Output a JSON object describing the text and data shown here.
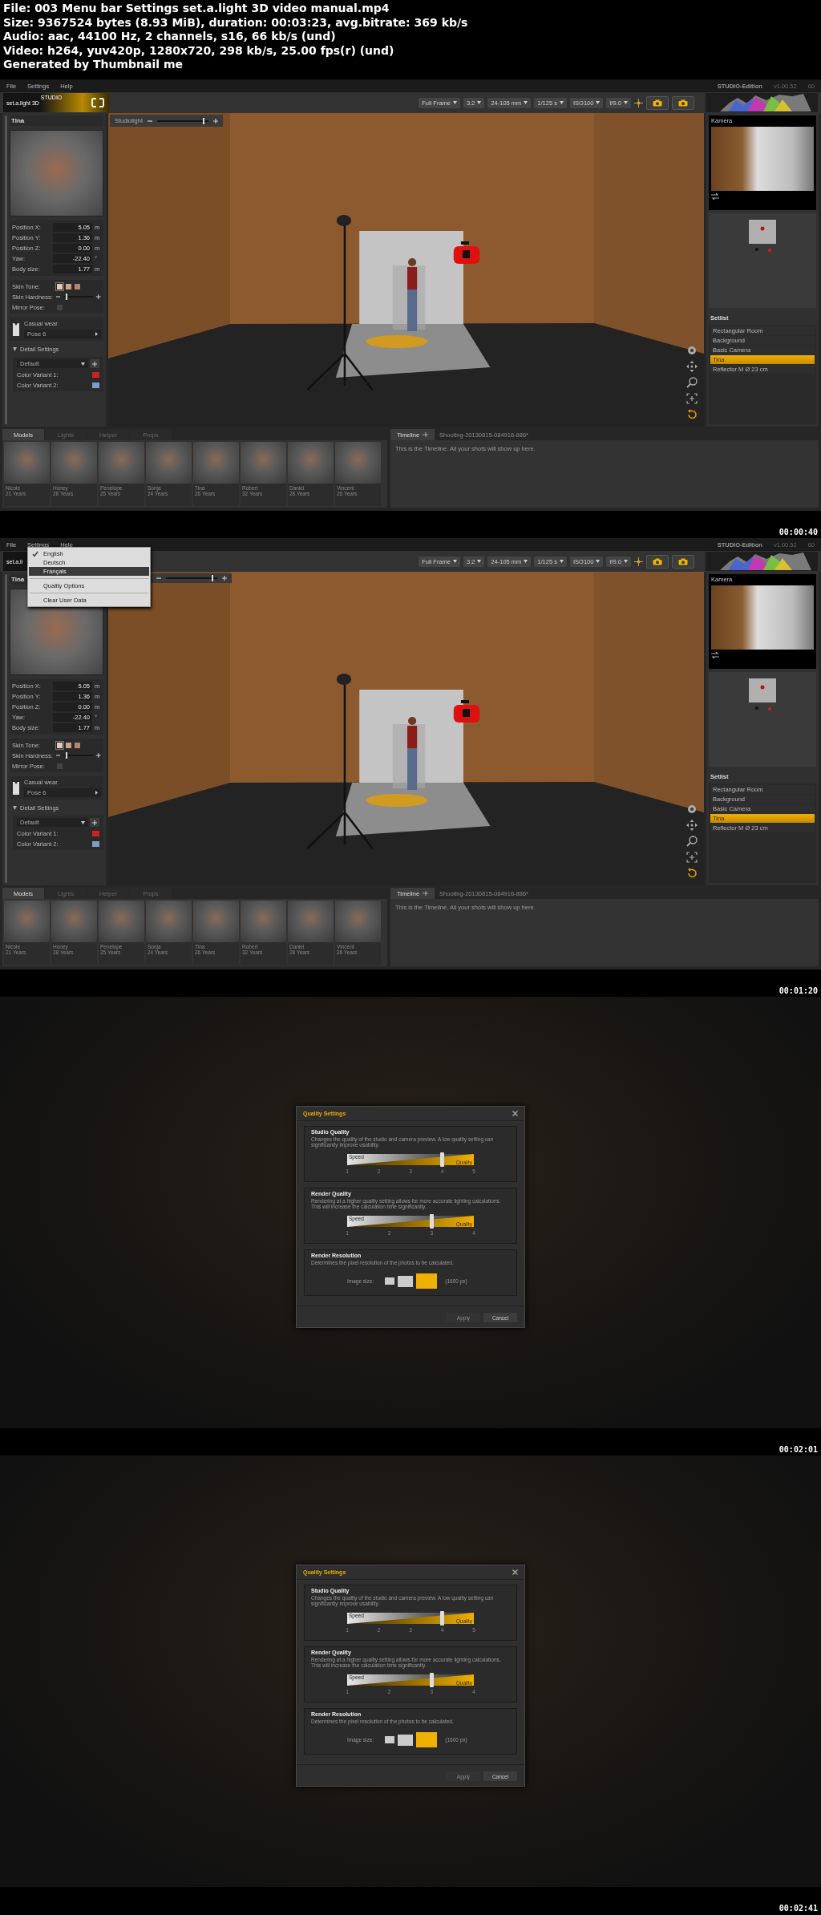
{
  "header": {
    "lines": [
      "File: 003 Menu bar  Settings   set.a.light 3D video manual.mp4",
      "Size: 9367524 bytes (8.93 MiB), duration: 00:03:23, avg.bitrate: 369 kb/s",
      "Audio: aac, 44100 Hz, 2 channels, s16, 66 kb/s (und)",
      "Video: h264, yuv420p, 1280x720, 298 kb/s, 25.00 fps(r) (und)",
      "Generated by Thumbnail me"
    ]
  },
  "frames": [
    {
      "timestamp": "00:00:40",
      "app": {
        "menubar": [
          "File",
          "Settings",
          "Help"
        ],
        "edition": "STUDIO-Edition",
        "version": "v1.00.52",
        "build": "60",
        "logo": "set.a.light 3D",
        "logo_edition": "STUDIO",
        "camera_settings": [
          "Full Frame",
          "3:2",
          "24-105 mm",
          "1/125 s",
          "ISO100",
          "f/9.0"
        ],
        "model_panel": {
          "title": "Tina",
          "fields": [
            {
              "label": "Position X:",
              "value": "5.05",
              "unit": "m"
            },
            {
              "label": "Position Y:",
              "value": "1.36",
              "unit": "m"
            },
            {
              "label": "Position Z:",
              "value": "0.00",
              "unit": "m"
            },
            {
              "label": "Yaw:",
              "value": "-22.40",
              "unit": "°"
            },
            {
              "label": "Body size:",
              "value": "1.77",
              "unit": "m"
            }
          ],
          "skin_tone": {
            "label": "Skin Tone:",
            "swatches": [
              {
                "color": "#e6cbbb",
                "selected": true
              },
              {
                "color": "#cfa48f",
                "selected": false
              },
              {
                "color": "#b8826f",
                "selected": false
              }
            ]
          },
          "skin_hardness": {
            "label": "Skin Hardness:",
            "level": 0.1
          },
          "mirror_pose": {
            "label": "Mirror Pose:",
            "checked": false
          },
          "outfit": "Casual wear",
          "pose": "Pose 6",
          "detail_settings": {
            "label": "Detail Settings",
            "expanded": true,
            "preset": "Default",
            "variants": [
              {
                "label": "Color Variant 1:",
                "color": "#cc2222"
              },
              {
                "label": "Color Variant 2:",
                "color": "#7f9cc8"
              }
            ]
          }
        },
        "studiolight": {
          "label": "Studiolight",
          "level": 0.9
        },
        "preview": {
          "title": "Kamera"
        },
        "setlist": {
          "title": "Setlist",
          "items": [
            {
              "label": "Rectangular Room",
              "selected": false
            },
            {
              "label": "Background",
              "selected": false
            },
            {
              "label": "Basic Camera",
              "selected": false
            },
            {
              "label": "Tina",
              "selected": true
            },
            {
              "label": "Reflector M Ø 23 cm",
              "selected": false
            }
          ]
        },
        "tabs": [
          {
            "label": "Models",
            "selected": true
          },
          {
            "label": "Lights",
            "selected": false
          },
          {
            "label": "Helper",
            "selected": false
          },
          {
            "label": "Props",
            "selected": false
          }
        ],
        "models": [
          {
            "name": "Nicole",
            "age": "21 Years"
          },
          {
            "name": "Honey",
            "age": "28 Years"
          },
          {
            "name": "Penelope",
            "age": "25 Years"
          },
          {
            "name": "Sonja",
            "age": "24 Years"
          },
          {
            "name": "Tina",
            "age": "26 Years"
          },
          {
            "name": "Robert",
            "age": "32 Years"
          },
          {
            "name": "Daniel",
            "age": "28 Years"
          },
          {
            "name": "Vincent",
            "age": "26 Years"
          }
        ],
        "timeline": {
          "tab": "Timeline",
          "session": "Shooting-20130815-084916-886*",
          "message": "This is the Timeline. All your shots will show up here."
        }
      }
    },
    {
      "timestamp": "00:01:20",
      "app": {
        "menubar": [
          "File",
          "Settings",
          "Help"
        ],
        "edition": "STUDIO-Edition",
        "version": "v1.00.52",
        "build": "60",
        "logo": "set.a.li",
        "camera_settings": [
          "Full Frame",
          "3:2",
          "24-105 mm",
          "1/125 s",
          "ISO100",
          "f/9.0"
        ],
        "model_panel": {
          "title": "Tina",
          "fields": [
            {
              "label": "Position X:",
              "value": "5.05",
              "unit": "m"
            },
            {
              "label": "Position Y:",
              "value": "1.36",
              "unit": "m"
            },
            {
              "label": "Position Z:",
              "value": "0.00",
              "unit": "m"
            },
            {
              "label": "Yaw:",
              "value": "-22.40",
              "unit": "°"
            },
            {
              "label": "Body size:",
              "value": "1.77",
              "unit": "m"
            }
          ],
          "skin_tone": {
            "label": "Skin Tone:",
            "swatches": [
              {
                "color": "#e6cbbb",
                "selected": true
              },
              {
                "color": "#cfa48f",
                "selected": false
              },
              {
                "color": "#b8826f",
                "selected": false
              }
            ]
          },
          "skin_hardness": {
            "label": "Skin Hardness:",
            "level": 0.1
          },
          "mirror_pose": {
            "label": "Mirror Pose:",
            "checked": false
          },
          "outfit": "Casual wear",
          "pose": "Pose 6",
          "detail_settings": {
            "label": "Detail Settings",
            "expanded": true,
            "preset": "Default",
            "variants": [
              {
                "label": "Color Variant 1:",
                "color": "#cc2222"
              },
              {
                "label": "Color Variant 2:",
                "color": "#7f9cc8"
              }
            ]
          }
        },
        "studiolight": {
          "level": 0.9
        },
        "preview": {
          "title": "Kamera"
        },
        "setlist": {
          "title": "Setlist",
          "items": [
            {
              "label": "Rectangular Room",
              "selected": false
            },
            {
              "label": "Background",
              "selected": false
            },
            {
              "label": "Basic Camera",
              "selected": false
            },
            {
              "label": "Tina",
              "selected": true
            },
            {
              "label": "Reflector M Ø 23 cm",
              "selected": false
            }
          ]
        },
        "tabs": [
          {
            "label": "Models",
            "selected": true
          },
          {
            "label": "Lights",
            "selected": false
          },
          {
            "label": "Helper",
            "selected": false
          },
          {
            "label": "Props",
            "selected": false
          }
        ],
        "models": [
          {
            "name": "Nicole",
            "age": "21 Years"
          },
          {
            "name": "Honey",
            "age": "28 Years"
          },
          {
            "name": "Penelope",
            "age": "25 Years"
          },
          {
            "name": "Sonja",
            "age": "24 Years"
          },
          {
            "name": "Tina",
            "age": "26 Years"
          },
          {
            "name": "Robert",
            "age": "32 Years"
          },
          {
            "name": "Daniel",
            "age": "28 Years"
          },
          {
            "name": "Vincent",
            "age": "26 Years"
          }
        ],
        "timeline": {
          "tab": "Timeline",
          "session": "Shooting-20130815-084916-886*",
          "message": "This is the Timeline. All your shots will show up here."
        }
      },
      "menu": {
        "groups": [
          [
            {
              "label": "English",
              "checked": true,
              "selected": false
            },
            {
              "label": "Deutsch",
              "checked": false,
              "selected": false
            },
            {
              "label": "Français",
              "checked": false,
              "selected": true
            }
          ],
          [
            {
              "label": "Quality Options",
              "checked": false,
              "selected": false
            }
          ],
          [
            {
              "label": "Clear User Data",
              "checked": false,
              "selected": false
            }
          ]
        ]
      }
    },
    {
      "timestamp": "00:02:01",
      "dialog": {
        "title": "Quality Settings",
        "sections": [
          {
            "kind": "slider",
            "title": "Studio Quality",
            "text": "Changes the quality of the studio and camera preview. A low quality setting can significantly improve usability.",
            "start": "Speed",
            "end": "Quality",
            "ticks": [
              "1",
              "2",
              "3",
              "4",
              "5"
            ],
            "level": 0.75
          },
          {
            "kind": "slider",
            "title": "Render Quality",
            "text": "Rendering at a higher quality setting allows for more accurate lighting calculations. This will increase the calculation time significantly.",
            "start": "Speed",
            "end": "Quality",
            "ticks": [
              "1",
              "2",
              "3",
              "4"
            ],
            "level": 0.667
          },
          {
            "kind": "size",
            "title": "Render Resolution",
            "text": "Determines the pixel resolution of the photos to be calculated.",
            "label": "Image size:",
            "options": [
              {
                "selected": false
              },
              {
                "selected": false
              },
              {
                "selected": true
              }
            ],
            "reading": "(1600 px)"
          }
        ],
        "buttons": [
          {
            "label": "Apply",
            "disabled": true
          },
          {
            "label": "Cancel",
            "disabled": false
          }
        ]
      }
    },
    {
      "timestamp": "00:02:41",
      "dialog": {
        "title": "Quality Settings",
        "sections": [
          {
            "kind": "slider",
            "title": "Studio Quality",
            "text": "Changes the quality of the studio and camera preview. A low quality setting can significantly improve usability.",
            "start": "Speed",
            "end": "Quality",
            "ticks": [
              "1",
              "2",
              "3",
              "4",
              "5"
            ],
            "level": 0.75
          },
          {
            "kind": "slider",
            "title": "Render Quality",
            "text": "Rendering at a higher quality setting allows for more accurate lighting calculations. This will increase the calculation time significantly.",
            "start": "Speed",
            "end": "Quality",
            "ticks": [
              "1",
              "2",
              "3",
              "4"
            ],
            "level": 0.667
          },
          {
            "kind": "size",
            "title": "Render Resolution",
            "text": "Determines the pixel resolution of the photos to be calculated.",
            "label": "Image size:",
            "options": [
              {
                "selected": false
              },
              {
                "selected": false
              },
              {
                "selected": true
              }
            ],
            "reading": "(1600 px)"
          }
        ],
        "buttons": [
          {
            "label": "Apply",
            "disabled": true
          },
          {
            "label": "Cancel",
            "disabled": false
          }
        ]
      }
    }
  ]
}
